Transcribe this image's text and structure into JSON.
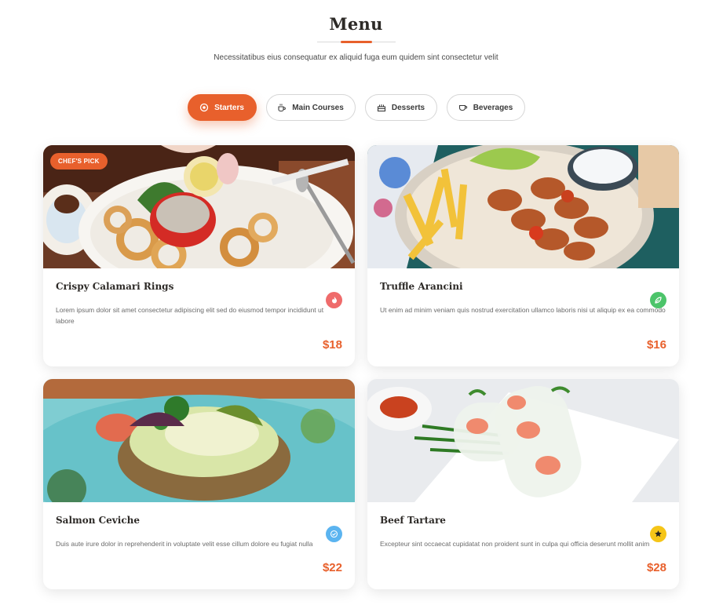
{
  "header": {
    "title": "Menu",
    "subtitle": "Necessitatibus eius consequatur ex aliquid fuga eum quidem sint consectetur velit"
  },
  "tabs": [
    {
      "label": "Starters",
      "icon": "food-icon",
      "active": true
    },
    {
      "label": "Main Courses",
      "icon": "coffee-cup-icon",
      "active": false
    },
    {
      "label": "Desserts",
      "icon": "cake-icon",
      "active": false
    },
    {
      "label": "Beverages",
      "icon": "cup-icon",
      "active": false
    }
  ],
  "items": [
    {
      "name": "Crispy Calamari Rings",
      "description": "Lorem ipsum dolor sit amet consectetur adipiscing elit sed do eiusmod tempor incididunt ut labore",
      "price": "$18",
      "badge": "CHEF'S PICK",
      "tag_icon": "flame-icon",
      "tag_color": "#ef6b6b"
    },
    {
      "name": "Truffle Arancini",
      "description": "Ut enim ad minim veniam quis nostrud exercitation ullamco laboris nisi ut aliquip ex ea commodo",
      "price": "$16",
      "badge": "",
      "tag_icon": "leaf-icon",
      "tag_color": "#4cc46a"
    },
    {
      "name": "Salmon Ceviche",
      "description": "Duis aute irure dolor in reprehenderit in voluptate velit esse cillum dolore eu fugiat nulla",
      "price": "$22",
      "badge": "",
      "tag_icon": "check-badge-icon",
      "tag_color": "#5bb4f0"
    },
    {
      "name": "Beef Tartare",
      "description": "Excepteur sint occaecat cupidatat non proident sunt in culpa qui officia deserunt mollit anim",
      "price": "$28",
      "badge": "",
      "tag_icon": "star-icon",
      "tag_color": "#f5c518"
    }
  ],
  "colors": {
    "accent": "#e8602c",
    "title": "#2d2a27"
  }
}
